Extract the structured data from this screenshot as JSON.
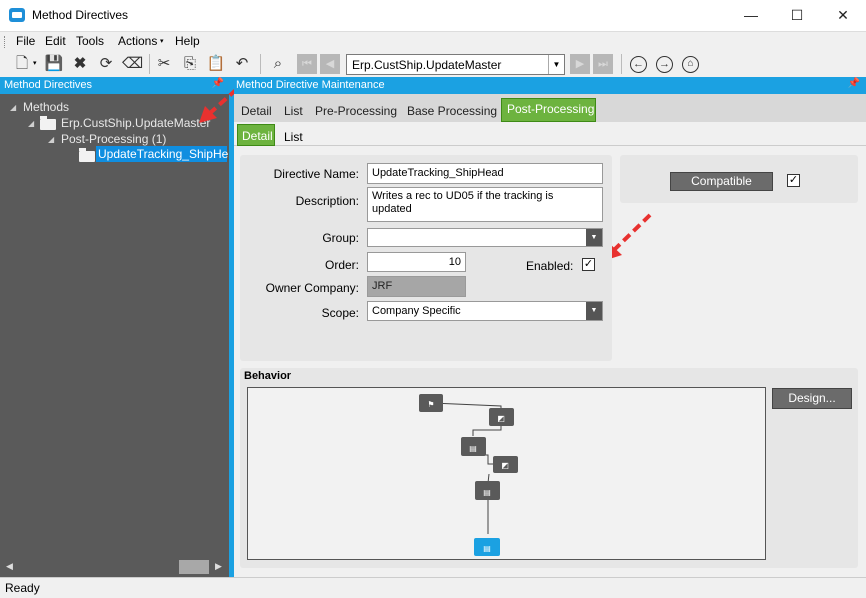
{
  "window": {
    "title": "Method Directives",
    "minimize": "—",
    "maximize": "☐",
    "close": "✕"
  },
  "menu": [
    "File",
    "Edit",
    "Tools",
    "Actions",
    "Help"
  ],
  "toolbar": {
    "nav_value": "Erp.CustShip.UpdateMaster"
  },
  "left_panel": {
    "header": "Method Directives",
    "tree": {
      "root": "Methods",
      "method": "Erp.CustShip.UpdateMaster",
      "group": "Post-Processing (1)",
      "directive": "UpdateTracking_ShipHe"
    }
  },
  "right_panel": {
    "header": "Method Directive Maintenance",
    "tabs": [
      "Detail",
      "List",
      "Pre-Processing",
      "Base Processing",
      "Post-Processing"
    ],
    "subtabs": [
      "Detail",
      "List"
    ],
    "form": {
      "directive_name_label": "Directive Name:",
      "directive_name": "UpdateTracking_ShipHead",
      "description_label": "Description:",
      "description": "Writes a rec to UD05 if the tracking is updated",
      "group_label": "Group:",
      "group": "",
      "order_label": "Order:",
      "order": "10",
      "enabled_label": "Enabled:",
      "enabled": true,
      "owner_company_label": "Owner Company:",
      "owner_company": "JRF",
      "scope_label": "Scope:",
      "scope": "Company Specific"
    },
    "compatible_label": "Compatible",
    "compatible": true,
    "behavior_title": "Behavior",
    "design_label": "Design..."
  },
  "status": "Ready",
  "colors": {
    "accent": "#1ba1e2",
    "tab_active": "#6db33f",
    "arrow": "#e8312f"
  }
}
